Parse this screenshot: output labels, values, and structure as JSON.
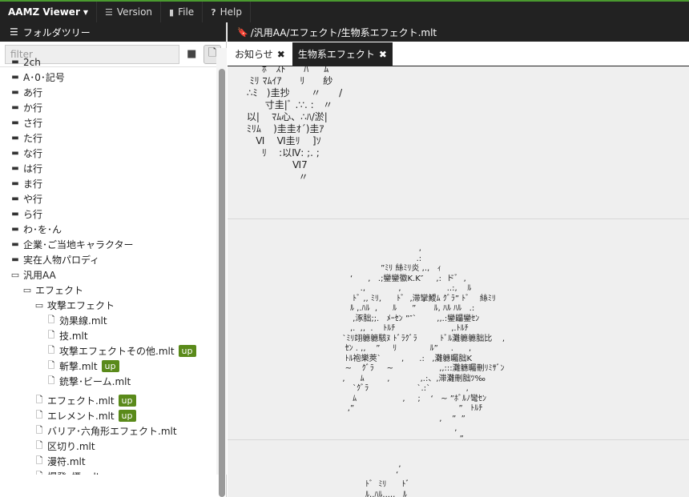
{
  "navbar": {
    "brand": "AAMZ Viewer",
    "items": [
      {
        "icon": "database-icon",
        "glyph": "☰",
        "label": "Version"
      },
      {
        "icon": "file-icon",
        "glyph": "🗋",
        "label": "File"
      },
      {
        "icon": "help-icon",
        "glyph": "?",
        "label": "Help"
      }
    ]
  },
  "left": {
    "header": "フォルダツリー",
    "filter_placeholder": "filter",
    "tree": [
      {
        "label": "2ch",
        "type": "folder",
        "depth": 0
      },
      {
        "label": "A･0･記号",
        "type": "folder",
        "depth": 0
      },
      {
        "label": "あ行",
        "type": "folder",
        "depth": 0
      },
      {
        "label": "か行",
        "type": "folder",
        "depth": 0
      },
      {
        "label": "さ行",
        "type": "folder",
        "depth": 0
      },
      {
        "label": "た行",
        "type": "folder",
        "depth": 0
      },
      {
        "label": "な行",
        "type": "folder",
        "depth": 0
      },
      {
        "label": "は行",
        "type": "folder",
        "depth": 0
      },
      {
        "label": "ま行",
        "type": "folder",
        "depth": 0
      },
      {
        "label": "や行",
        "type": "folder",
        "depth": 0
      },
      {
        "label": "ら行",
        "type": "folder",
        "depth": 0
      },
      {
        "label": "わ･を･ん",
        "type": "folder",
        "depth": 0
      },
      {
        "label": "企業･ご当地キャラクター",
        "type": "folder",
        "depth": 0
      },
      {
        "label": "実在人物パロディ",
        "type": "folder",
        "depth": 0
      },
      {
        "label": "汎用AA",
        "type": "folder-open",
        "depth": 0
      },
      {
        "label": "エフェクト",
        "type": "folder-open",
        "depth": 1
      },
      {
        "label": "攻撃エフェクト",
        "type": "folder-open",
        "depth": 2
      },
      {
        "label": "効果線.mlt",
        "type": "file",
        "depth": 3
      },
      {
        "label": "技.mlt",
        "type": "file",
        "depth": 3
      },
      {
        "label": "攻撃エフェクトその他.mlt",
        "type": "file",
        "depth": 3,
        "badge": "up"
      },
      {
        "label": "斬撃.mlt",
        "type": "file",
        "depth": 3,
        "badge": "up"
      },
      {
        "label": "銃撃･ビーム.mlt",
        "type": "file",
        "depth": 3
      },
      {
        "label": "エフェクト.mlt",
        "type": "file",
        "depth": 2,
        "badge": "up",
        "gap": true
      },
      {
        "label": "エレメント.mlt",
        "type": "file",
        "depth": 2,
        "badge": "up"
      },
      {
        "label": "バリア･六角形エフェクト.mlt",
        "type": "file",
        "depth": 2
      },
      {
        "label": "区切り.mlt",
        "type": "file",
        "depth": 2
      },
      {
        "label": "漫符.mlt",
        "type": "file",
        "depth": 2
      },
      {
        "label": "爆発･煙.mlt",
        "type": "file",
        "depth": 2
      }
    ]
  },
  "right": {
    "path": "/汎用AA/エフェクト/生物系エフェクト.mlt",
    "tabs": [
      {
        "label": "お知らせ",
        "active": false
      },
      {
        "label": "生物系エフェクト",
        "active": true
      }
    ],
    "aa_blocks": [
      "      ﾎ   ｽﾄ      ﾊ     ﾑ\n  ﾐﾘ ﾏﾑｲｱ      ﾘ      紗\n ∴ﾐ   )圭抄       〃      /\n       寸圭|ﾞ .∵. :   〃\n 以|    ﾏﾑ心、∴ﾊ/淤|\n ﾐﾘﾑ    )圭圭ｵ´)圭ｱ\n    Ⅵ    Ⅵ圭ﾘ    ]ｿ\n      ﾘ    :以Ⅳ: ;. ;\n                Ⅵ7\n                  〃",
      "                                      ,\n                                     .:\n                       ”ﾐﾘ 絲ﾐﾘ炎 ,.,   ｨ\n           ‘      ,   .;鑾鑾徽K.K″     ,:  ドﾞ  ,\n               .,             ,                  ..:,    ﾙ\n            ﾄﾞ ,, ﾐﾘ,      ﾄﾞ  ,滞攣鱫ﾑ ｸﾞﾗ” ﾄﾞ    絲ﾐﾘ\n           ﾙ ,.ﾊﾙ  ,      ﾙ      ”       ﾙ, ﾊﾙ ﾊﾙ   .:\n            ,涿朏;;.   ﾒｰｾﾝ ”″`        ,,.:鑾鼺鑾ｾﾝ\n           ,.  ,,  .    ﾄﾙﾁ                      ,.ﾄﾙﾁ\n        `ﾐﾘ翊軈軈駭ﾇ ﾄﾞﾗｸﾞﾗ         ﾄﾞﾙ灘軈軈朏比    ,\n         ｾﾝ . ,,    ”     ﾘ             ﾙ”     .      ,\n         ﾄﾙ袍樂莢`        ,      .:   ,灘軈矚朏K\n         ~    ｸﾞﾗ     ~                  ,,:::灘軈矚刪ﾘﾐｻﾞﾝ\n        ,      ﾑ         ,            ,.:、,滞灘刪朏ﾂ‰\n            `ｸﾞﾗ                   `.:`              ,\n            ﾑ                  ,     ;    ‘   ~ ”ﾎﾞﾙﾉ彎ｾﾝ\n          ,”                                         ”   ﾄﾙﾁ\n                                              ,    ”  ”\n                                                    ,\n                                                      ”",
      "                              ,\n                             ‘\n                 ﾄﾞ  ﾐﾘ      ﾄﾞ\n                 ﾙ,.ﾊﾙ...,,   ﾙ"
    ]
  }
}
